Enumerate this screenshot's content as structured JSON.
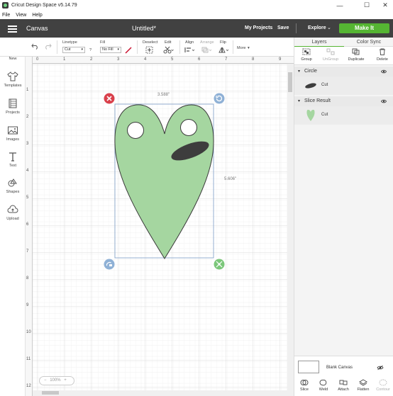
{
  "window": {
    "title": "Cricut Design Space  v5.14.79",
    "minimize": "—",
    "maximize": "☐",
    "close": "✕"
  },
  "menu": [
    "File",
    "View",
    "Help"
  ],
  "header": {
    "section": "Canvas",
    "doc_title": "Untitled*",
    "my_projects": "My Projects",
    "save": "Save",
    "explore": "Explore",
    "explore_caret": "⌄",
    "make_it": "Make It"
  },
  "toolbar": {
    "undo_icon": "undo-icon",
    "redo_icon": "redo-icon",
    "linetype_label": "Linetype",
    "linetype_value": "Cut",
    "linetype_help": "?",
    "fill_label": "Fill",
    "fill_value": "No Fill",
    "deselect_label": "Deselect",
    "edit_label": "Edit",
    "align_label": "Align",
    "arrange_label": "Arrange",
    "flip_label": "Flip",
    "more_label": "More",
    "more_caret": "▾"
  },
  "leftnav": [
    {
      "label": "New",
      "icon": "plus-icon"
    },
    {
      "label": "Templates",
      "icon": "shirt-icon"
    },
    {
      "label": "Projects",
      "icon": "projects-icon"
    },
    {
      "label": "Images",
      "icon": "image-icon"
    },
    {
      "label": "Text",
      "icon": "text-icon"
    },
    {
      "label": "Shapes",
      "icon": "shapes-icon"
    },
    {
      "label": "Upload",
      "icon": "upload-icon"
    }
  ],
  "rulers": {
    "top": [
      "0",
      "1",
      "2",
      "3",
      "4",
      "5",
      "6",
      "7",
      "8",
      "9"
    ],
    "left": [
      "1",
      "2",
      "3",
      "4",
      "5",
      "6",
      "7",
      "8",
      "9",
      "10",
      "11",
      "12"
    ]
  },
  "canvas": {
    "width_label": "3.588\"",
    "height_label": "5.606\"",
    "zoom": "100%",
    "fill_color": "#a5d6a0",
    "stroke_color": "#3a3a3a",
    "slot_color": "#3d3d3d"
  },
  "panel": {
    "tab_layers": "Layers",
    "tab_color_sync": "Color Sync",
    "actions": [
      {
        "label": "Group",
        "icon": "group-icon",
        "enabled": true
      },
      {
        "label": "UnGroup",
        "icon": "ungroup-icon",
        "enabled": false
      },
      {
        "label": "Duplicate",
        "icon": "duplicate-icon",
        "enabled": true
      },
      {
        "label": "Delete",
        "icon": "trash-icon",
        "enabled": true
      }
    ],
    "layers": [
      {
        "name": "Circle",
        "child_label": "Cut"
      },
      {
        "name": "Slice Result",
        "child_label": "Cut"
      }
    ],
    "blank_canvas": "Blank Canvas",
    "bottom_tools": [
      {
        "label": "Slice",
        "icon": "slice-icon",
        "enabled": true
      },
      {
        "label": "Weld",
        "icon": "weld-icon",
        "enabled": true
      },
      {
        "label": "Attach",
        "icon": "attach-icon",
        "enabled": true
      },
      {
        "label": "Flatten",
        "icon": "flatten-icon",
        "enabled": true
      },
      {
        "label": "Contour",
        "icon": "contour-icon",
        "enabled": false
      }
    ]
  }
}
